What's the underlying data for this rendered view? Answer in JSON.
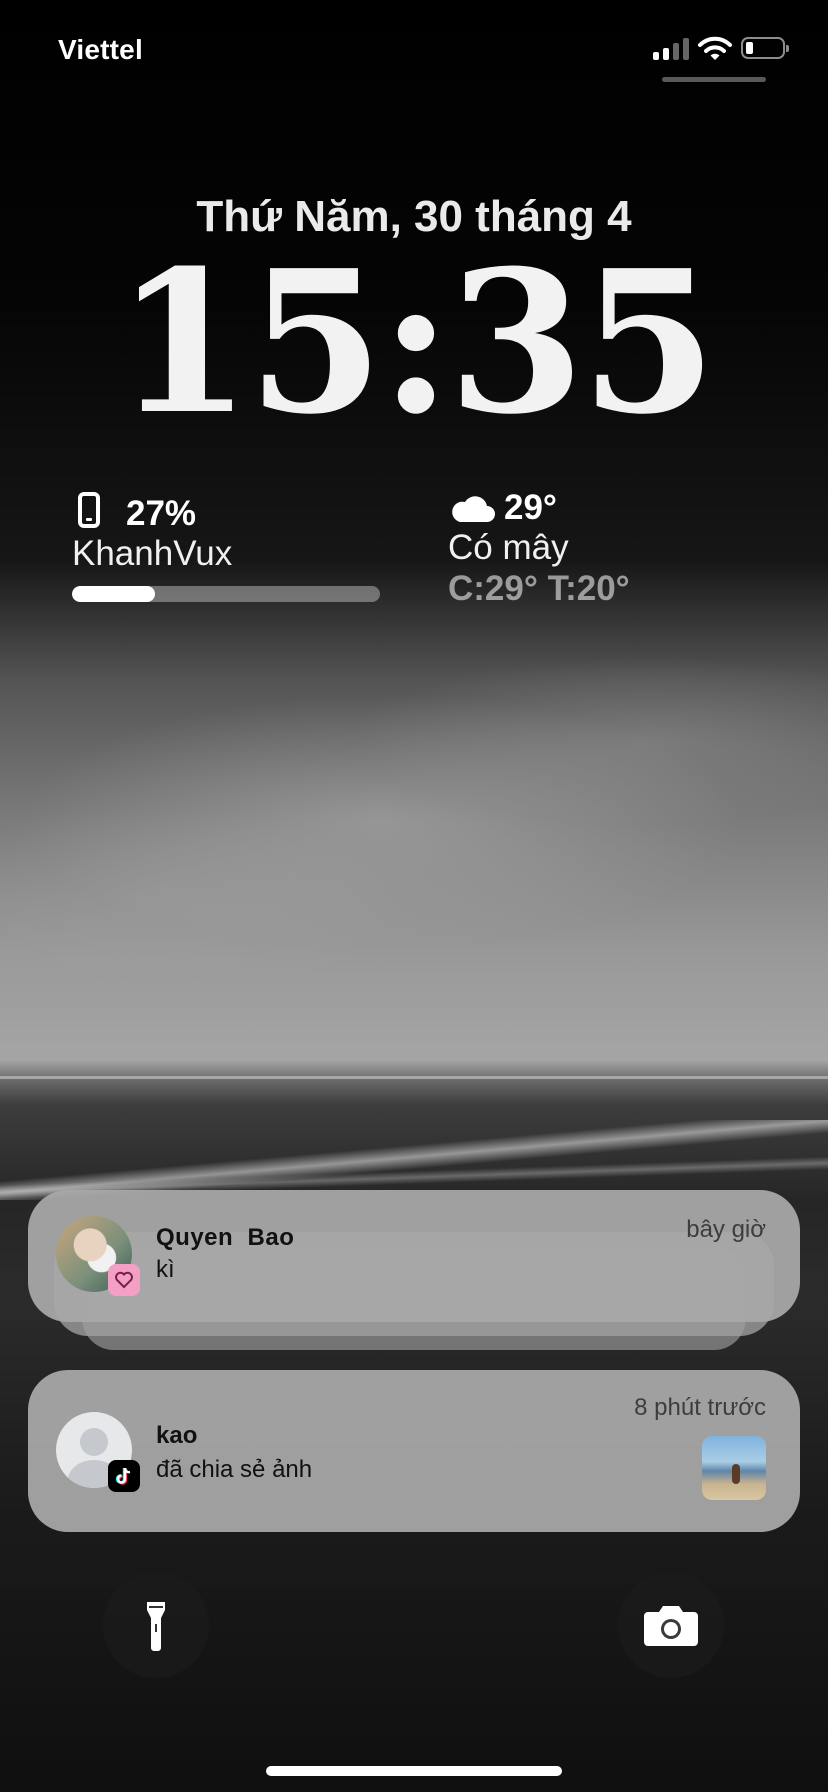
{
  "status_bar": {
    "carrier": "Viettel",
    "signal_bars": 2,
    "icons": [
      "signal-icon",
      "wifi-icon",
      "battery-icon"
    ],
    "battery_level": 0.2
  },
  "lock_screen": {
    "date": "Thứ Năm, 30 tháng 4",
    "time": "15:35"
  },
  "widgets": {
    "battery": {
      "icon": "phone-icon",
      "percent": "27%",
      "device": "KhanhVux",
      "level": 0.27
    },
    "weather": {
      "icon": "cloud-icon",
      "temperature": "29°",
      "condition": "Có mây",
      "range": "C:29° T:20°"
    }
  },
  "notifications": [
    {
      "sender": "Quyen  Bao",
      "message": "kì",
      "time": "bây giờ",
      "app_icon": "heart-icon"
    },
    {
      "sender": "kao",
      "message": "đã chia sẻ ảnh",
      "time": "8 phút trước",
      "app_icon": "tiktok-icon"
    }
  ],
  "quick_actions": {
    "left": "flashlight-icon",
    "right": "camera-icon"
  },
  "colors": {
    "text": "#ffffff",
    "notification_bg": "#a8a8a8",
    "pink_badge": "#f3a0c4"
  }
}
